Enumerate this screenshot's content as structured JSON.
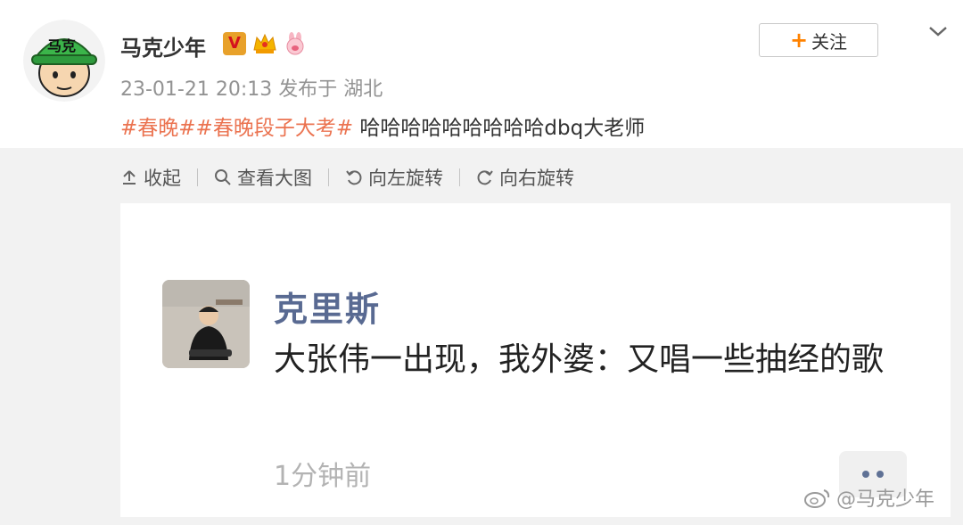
{
  "header": {
    "username": "马克少年",
    "badge_v": "V",
    "avatar_cap_text": "马克",
    "meta": "23-01-21 20:13 发布于 湖北",
    "follow_label": "关注",
    "follow_plus": "+"
  },
  "post": {
    "topics": [
      "#春晚#",
      "#春晚段子大考#"
    ],
    "text": " 哈哈哈哈哈哈哈哈哈dbq大老师"
  },
  "toolbar": {
    "collapse_label": "收起",
    "view_large_label": "查看大图",
    "rotate_left_label": "向左旋转",
    "rotate_right_label": "向右旋转"
  },
  "card": {
    "name": "克里斯",
    "text": "大张伟一出现，我外婆：又唱一些抽经的歌",
    "time": "1分钟前"
  },
  "watermark": "@马克少年",
  "colors": {
    "topic": "#eb7350",
    "plus": "#ff8200",
    "card_name": "#596a92",
    "gray_bg": "#f2f2f2"
  }
}
